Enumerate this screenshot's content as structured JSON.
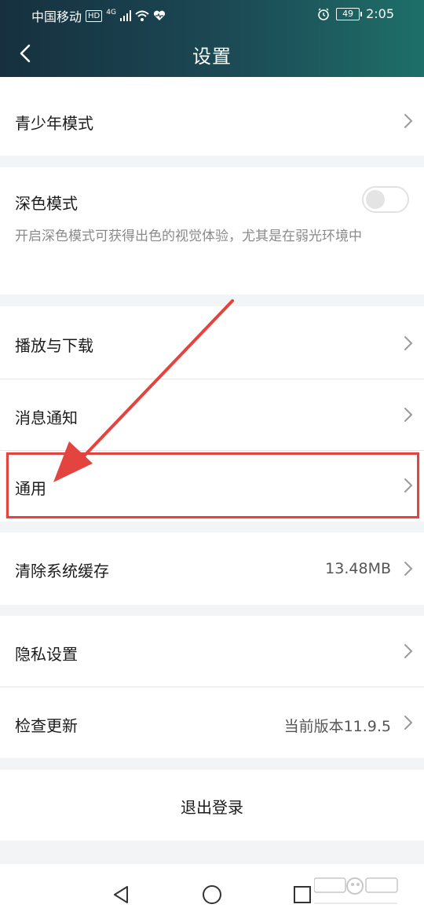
{
  "status_bar": {
    "carrier": "中国移动",
    "hd_badge": "HD",
    "network": "4G",
    "battery": "49",
    "time": "2:05"
  },
  "header": {
    "back_icon": "chevron-left-icon",
    "title": "设置"
  },
  "settings": {
    "youth_mode": {
      "label": "青少年模式"
    },
    "dark_mode": {
      "label": "深色模式",
      "description": "开启深色模式可获得出色的视觉体验，尤其是在弱光环境中",
      "enabled": false
    },
    "playback_download": {
      "label": "播放与下载"
    },
    "notifications": {
      "label": "消息通知"
    },
    "general": {
      "label": "通用"
    },
    "clear_cache": {
      "label": "清除系统缓存",
      "value": "13.48MB"
    },
    "privacy": {
      "label": "隐私设置"
    },
    "check_update": {
      "label": "检查更新",
      "value": "当前版本11.9.5"
    }
  },
  "logout": {
    "label": "退出登录"
  },
  "nav_bar": {
    "back_icon": "triangle-back-icon",
    "home_icon": "circle-home-icon",
    "recents_icon": "square-recents-icon"
  },
  "annotation": {
    "color": "#e3443f"
  }
}
